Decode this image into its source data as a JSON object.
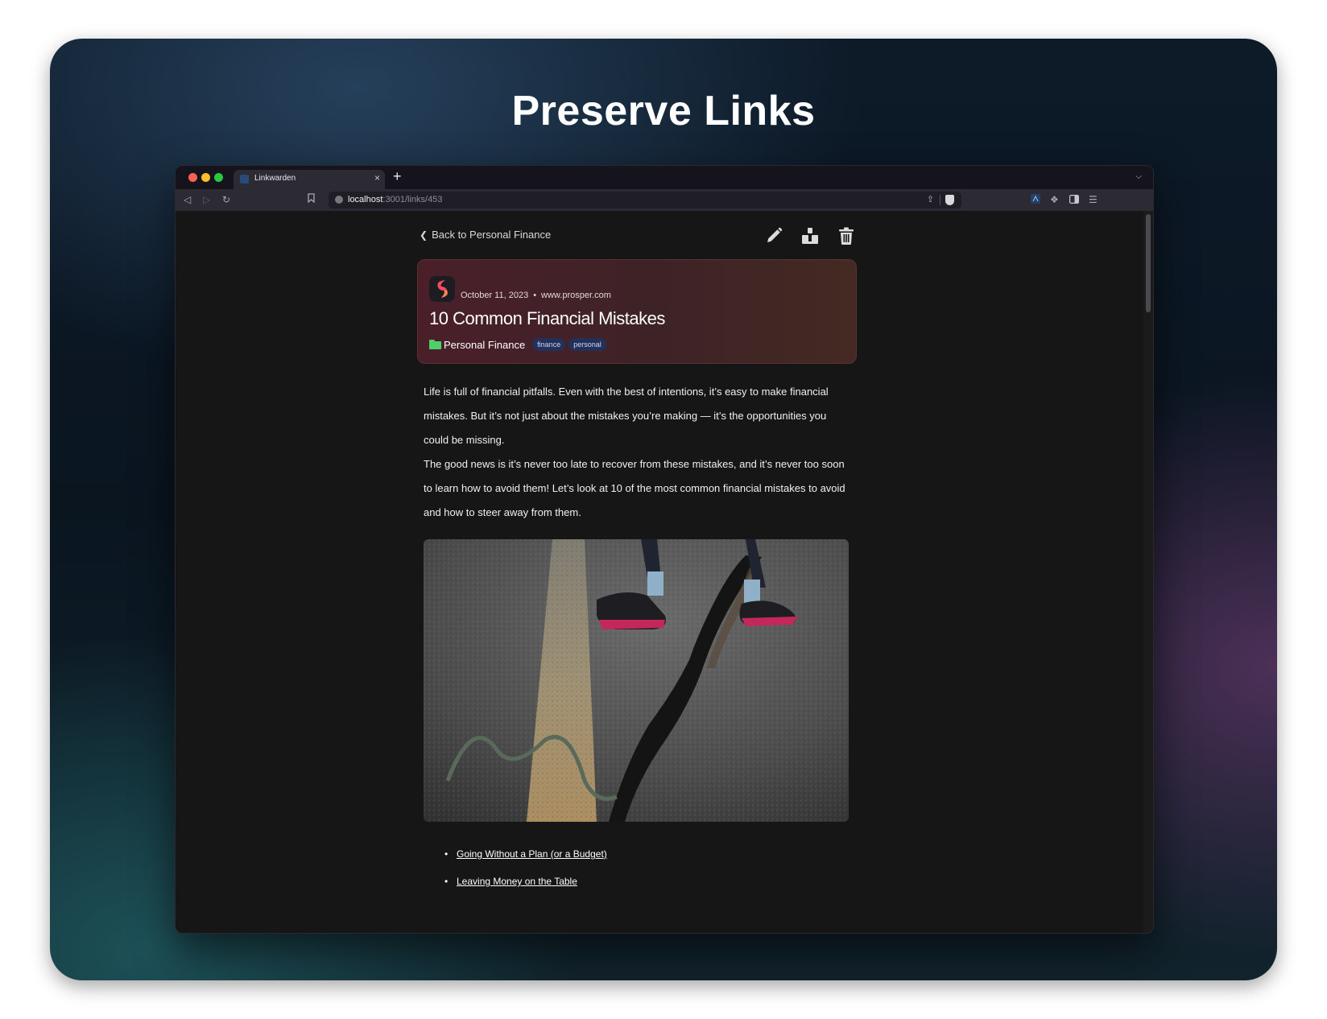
{
  "page": {
    "headline": "Preserve Links"
  },
  "browser": {
    "tab_title": "Linkwarden",
    "new_tab": "+",
    "tab_close": "×",
    "url_host": "localhost",
    "url_path": ":3001/links/453"
  },
  "link_view": {
    "back_label": "Back to Personal Finance",
    "date": "October 11, 2023",
    "separator": "•",
    "domain": "www.prosper.com",
    "title": "10 Common Financial Mistakes",
    "collection": "Personal Finance",
    "collection_color": "#4bd06a",
    "tags": [
      "finance",
      "personal"
    ],
    "actions": [
      "edit-icon",
      "archive-icon",
      "trash-icon"
    ]
  },
  "article": {
    "paragraph_1": "Life is full of financial pitfalls. Even with the best of intentions, it’s easy to make financial mistakes. But it’s not just about the mistakes you’re making — it’s the opportunities you could be missing.",
    "paragraph_2": "The good news is it’s never too late to recover from these mistakes, and it’s never too soon to learn how to avoid them! Let’s look at 10 of the most common financial mistakes to avoid and how to steer away from them.",
    "links": [
      "Going Without a Plan (or a Budget)",
      "Leaving Money on the Table"
    ]
  }
}
